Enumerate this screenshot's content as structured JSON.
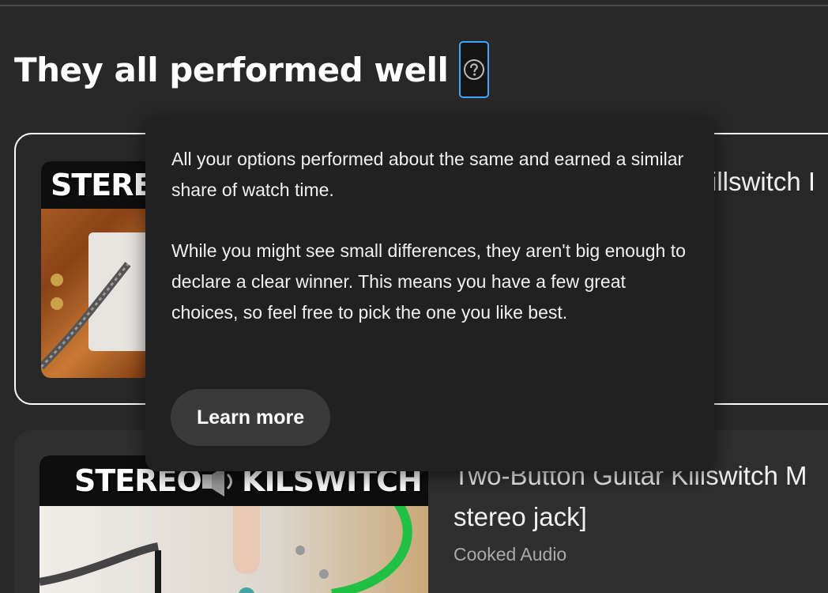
{
  "header": {
    "title": "They all performed well",
    "help_icon": "question-circle-icon"
  },
  "tooltip": {
    "paragraph_1": "All your options performed about the same and earned a similar share of watch time.",
    "paragraph_2": "While you might see small differences, they aren't big enough to declare a clear winner. This means you have a few great choices, so feel free to pick the one you like best.",
    "learn_more_label": "Learn more"
  },
  "cards": [
    {
      "thumbnail_text": "STEREO",
      "title_visible": "illswitch I"
    },
    {
      "thumbnail_text_left": "STEREO",
      "thumbnail_text_right": "KILSWITCH",
      "title_line1": "Two-Button Guitar Killswitch M",
      "title_line2": "stereo jack]",
      "channel": "Cooked Audio"
    }
  ],
  "colors": {
    "background": "#282828",
    "tooltip_bg": "#212121",
    "focus_ring": "#3ea6ff",
    "button_bg": "#3a3a3a",
    "secondary_text": "#aaaaaa"
  }
}
